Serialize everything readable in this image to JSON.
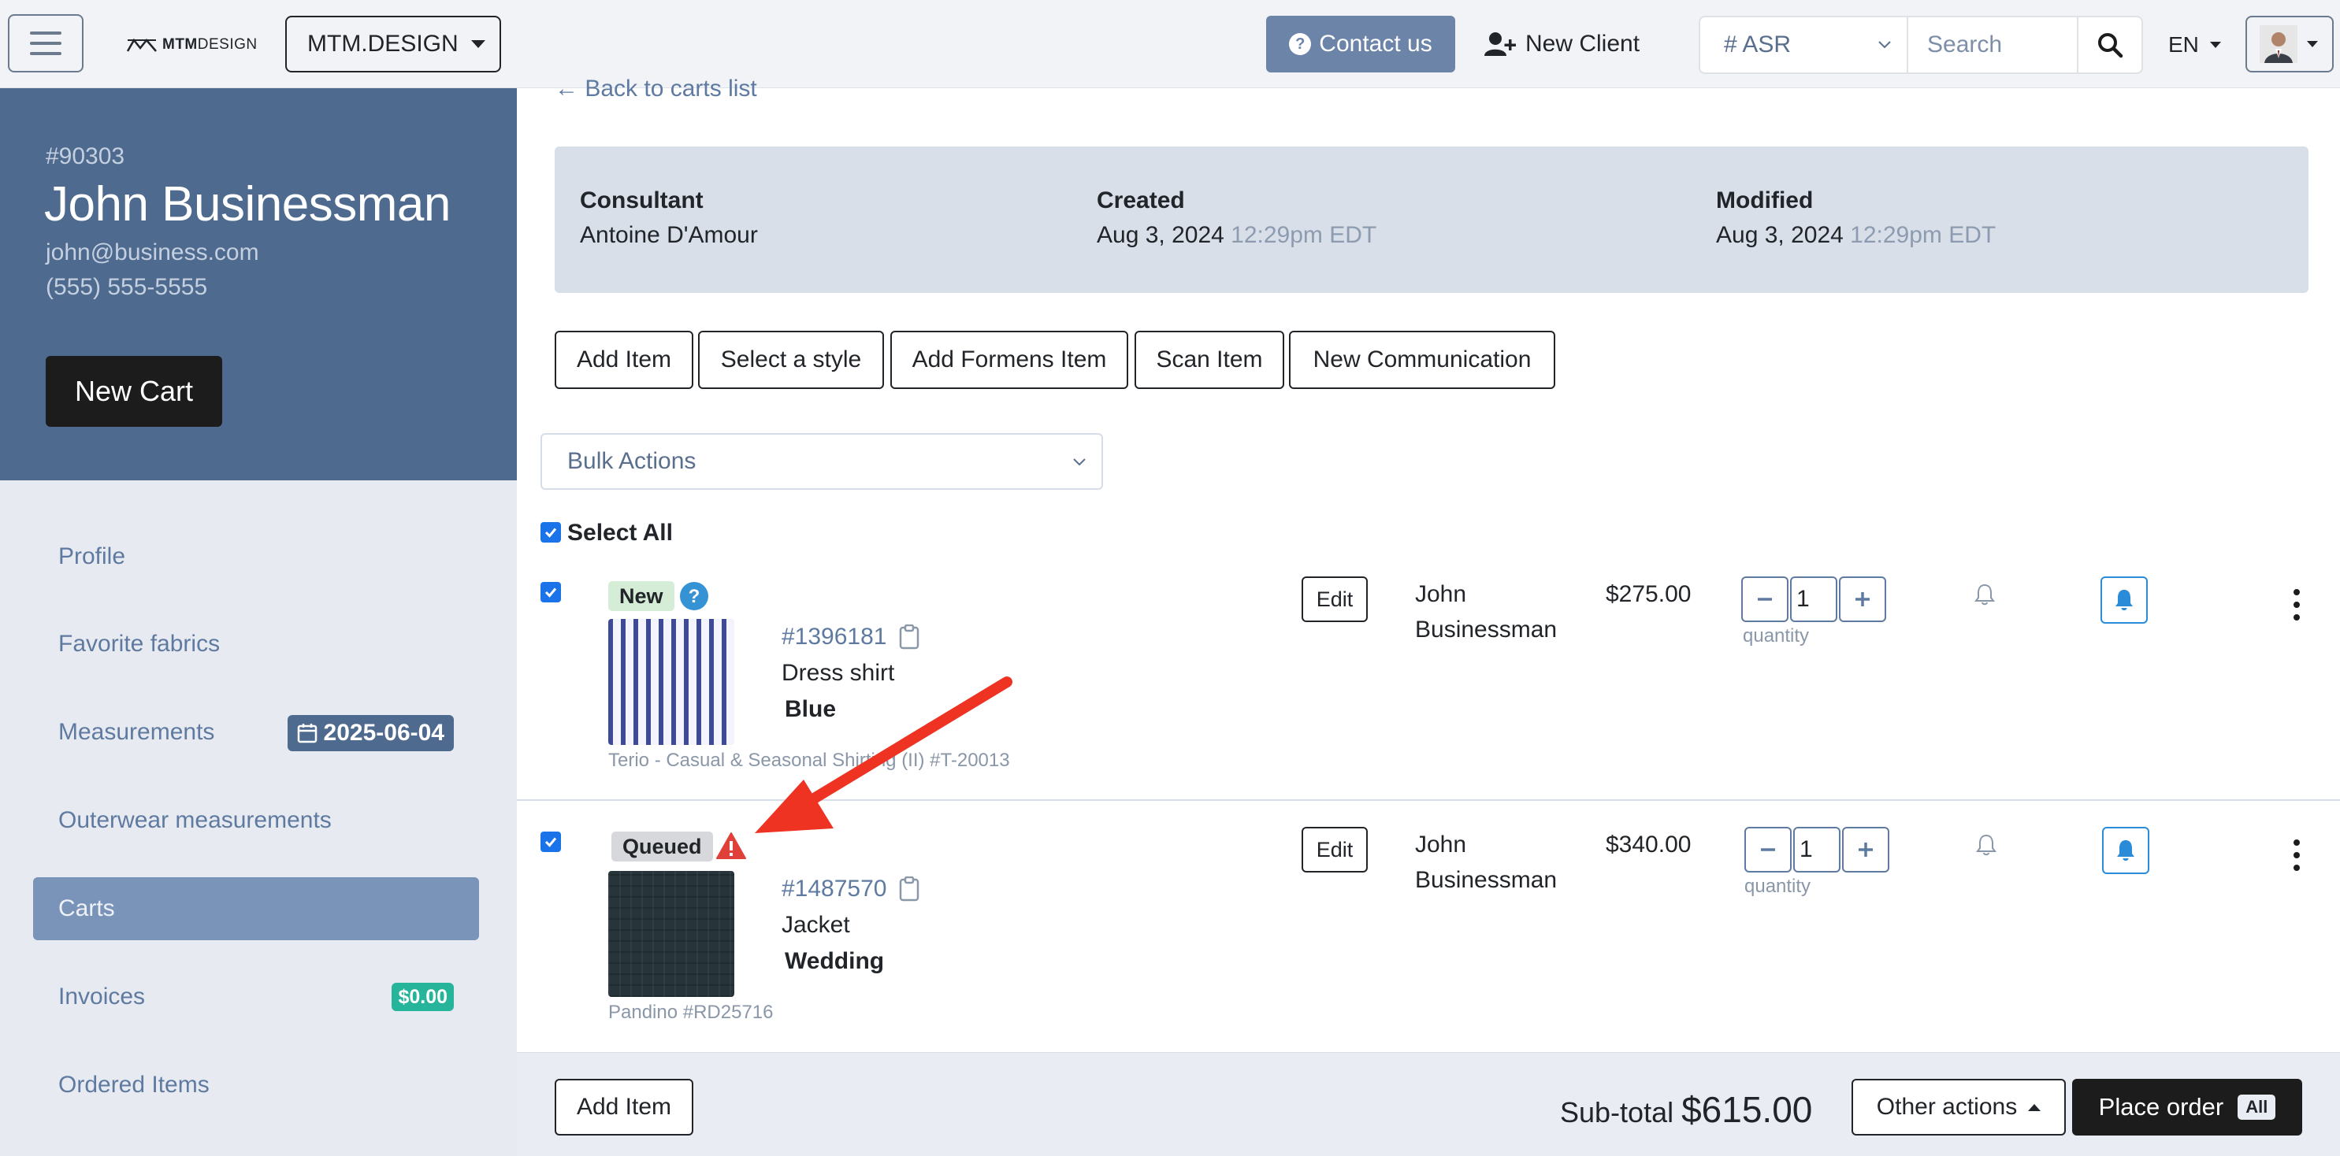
{
  "navbar": {
    "logo_bold": "MTM",
    "logo_rest": "DESIGN",
    "org_dropdown": "MTM.DESIGN",
    "contact_label": "Contact us",
    "new_client_label": "New Client",
    "asr_select": "# ASR",
    "search_placeholder": "Search",
    "language": "EN"
  },
  "client": {
    "id": "#90303",
    "name": "John Businessman",
    "email": "john@business.com",
    "phone": "(555) 555-5555",
    "new_cart_label": "New Cart"
  },
  "sidebar": {
    "items": [
      {
        "label": "Profile"
      },
      {
        "label": "Favorite fabrics"
      },
      {
        "label": "Measurements",
        "badge": "2025-06-04"
      },
      {
        "label": "Outerwear measurements"
      },
      {
        "label": "Carts",
        "active": true
      },
      {
        "label": "Invoices",
        "badge": "$0.00"
      },
      {
        "label": "Ordered Items"
      }
    ]
  },
  "cart": {
    "back_link": "← Back to carts list",
    "consultant_label": "Consultant",
    "consultant_value": "Antoine D'Amour",
    "created_label": "Created",
    "created_date": "Aug 3, 2024",
    "created_time": "12:29pm EDT",
    "modified_label": "Modified",
    "modified_date": "Aug 3, 2024",
    "modified_time": "12:29pm EDT"
  },
  "actions": {
    "add_item": "Add Item",
    "select_style": "Select a style",
    "add_formens": "Add Formens Item",
    "scan_item": "Scan Item",
    "new_communication": "New Communication"
  },
  "bulk_actions": "Bulk Actions",
  "select_all": "Select All",
  "items": [
    {
      "status": "New",
      "number": "#1396181",
      "type": "Dress shirt",
      "variant": "Blue",
      "fabric": "Terio - Casual & Seasonal Shirting (II) #T-20013",
      "edit": "Edit",
      "client_first": "John",
      "client_last": "Businessman",
      "price": "$275.00",
      "quantity": "1",
      "quantity_label": "quantity"
    },
    {
      "status": "Queued",
      "number": "#1487570",
      "type": "Jacket",
      "variant": "Wedding",
      "fabric": "Pandino #RD25716",
      "edit": "Edit",
      "client_first": "John",
      "client_last": "Businessman",
      "price": "$340.00",
      "quantity": "1",
      "quantity_label": "quantity"
    }
  ],
  "footer": {
    "add_item": "Add Item",
    "subtotal_label": "Sub-total",
    "subtotal_value": "$615.00",
    "other_actions": "Other actions",
    "place_order": "Place order",
    "place_order_badge": "All"
  },
  "colors": {
    "sidebar_header": "#4f6a8f",
    "sidebar_menu": "#e7ebf1",
    "active_item": "#7a93b8",
    "accent_link": "#5f7aa0",
    "new_badge": "#d5ecd7",
    "queued_badge": "#d6d8db",
    "warning": "#e0403a",
    "annotation_arrow": "#ee3322"
  }
}
